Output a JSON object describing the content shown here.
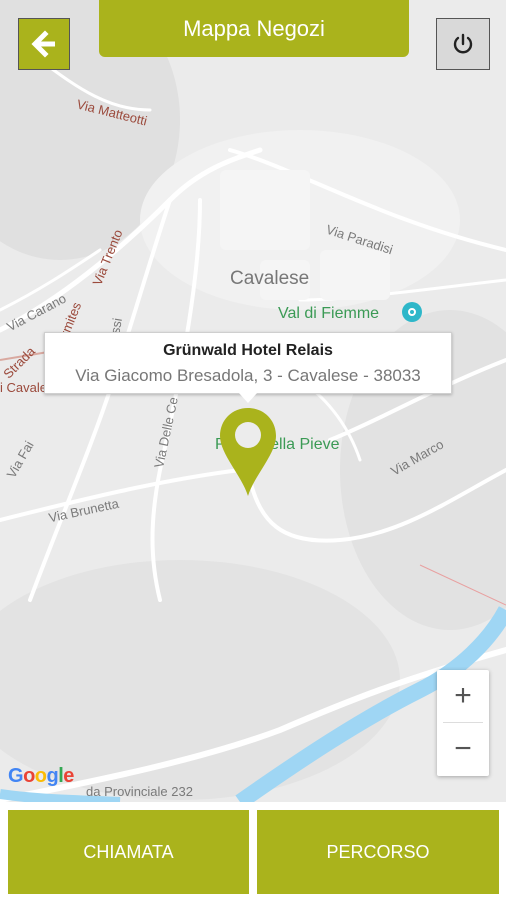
{
  "header": {
    "title": "Mappa Negozi",
    "back_icon": "arrow-left-icon",
    "power_icon": "power-icon"
  },
  "map": {
    "streets": {
      "via_matteotti": "Via Matteotti",
      "via_paradisi": "Via Paradisi",
      "via_carano": "Via Carano",
      "via_trento": "Via Trento",
      "ermites": "ermites",
      "stradale": "Strada",
      "ossi": "ossi",
      "cavalese_red": "i Cavalese",
      "via_fai": "Via Fai",
      "via_delle_ce": "Via Delle Ce",
      "via_brunetta": "Via Brunetta",
      "via_marco": "Via Marco",
      "provinciale": "da Provinciale 232"
    },
    "town": "Cavalese",
    "poi": {
      "val_di_fiemme": "Val di Fiemme",
      "parco": "Parco della Pieve"
    },
    "info_window": {
      "name": "Grünwald Hotel Relais",
      "address": "Via Giacomo Bresadola, 3 - Cavalese - 38033"
    },
    "zoom": {
      "in": "+",
      "out": "−"
    },
    "google_logo": [
      "G",
      "o",
      "o",
      "g",
      "l",
      "e"
    ]
  },
  "actions": {
    "call": "CHIAMATA",
    "route": "PERCORSO"
  },
  "colors": {
    "accent": "#aab31c",
    "map_bg": "#ececec",
    "river": "#9fd6f4",
    "poi_green": "#3b9a55"
  }
}
